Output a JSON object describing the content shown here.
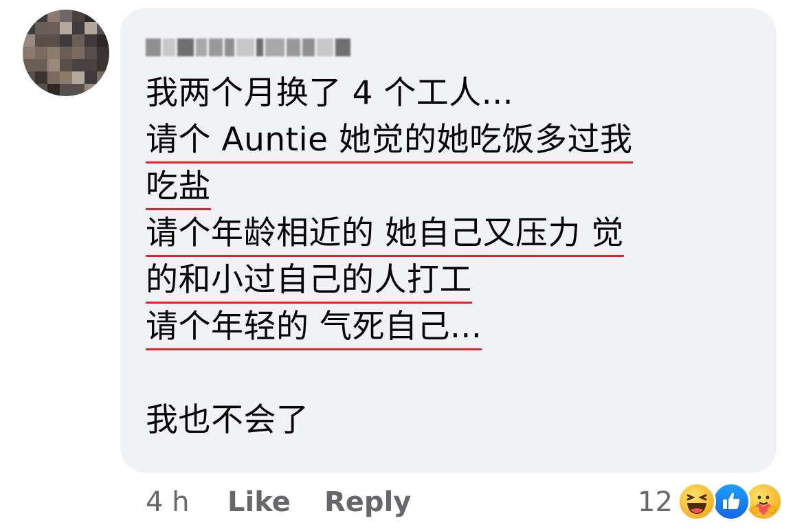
{
  "comment": {
    "lines": [
      "我两个月换了 4 个工人...",
      "请个 Auntie 她觉的她吃饭多过我",
      "吃盐",
      "请个年龄相近的 她自己又压力 觉",
      "的和小过自己的人打工",
      "请个年轻的 气死自己...",
      "",
      "我也不会了"
    ]
  },
  "footer": {
    "time": "4 h",
    "like_label": "Like",
    "reply_label": "Reply",
    "reaction_count": "12"
  },
  "reactions": [
    {
      "icon": "haha-reaction-icon"
    },
    {
      "icon": "like-reaction-icon"
    },
    {
      "icon": "care-reaction-icon"
    }
  ],
  "colors": {
    "bubble": "#f0f2f5",
    "underline": "#e0242f",
    "secondary_text": "#65676b",
    "like_blue": "#1877f2"
  }
}
